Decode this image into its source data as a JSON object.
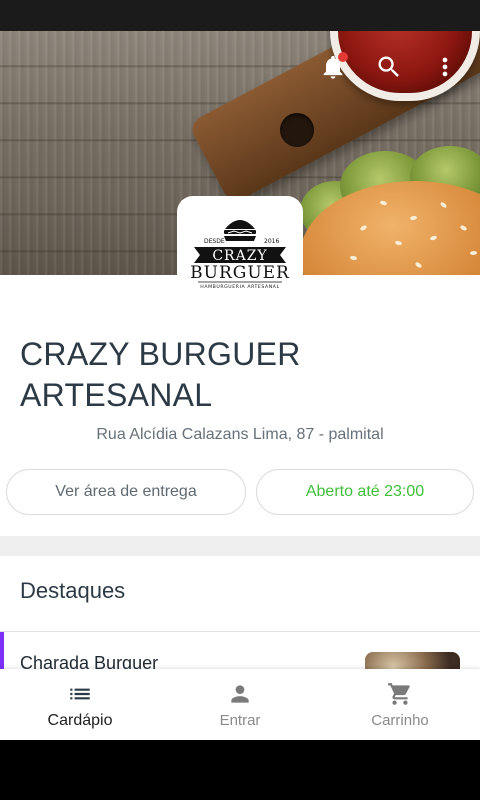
{
  "header": {
    "icons": [
      "notifications-icon",
      "search-icon",
      "more-vert-icon"
    ],
    "has_notification": true
  },
  "logo": {
    "since_left": "DESDE",
    "since_right": "2016",
    "line1": "CRAZY",
    "line2": "BURGUER",
    "tagline": "HAMBURGUERIA ARTESANAL"
  },
  "store": {
    "name": "CRAZY BURGUER ARTESANAL",
    "address": "Rua Alcídia Calazans Lima, 87 - palmital"
  },
  "actions": {
    "delivery_area": "Ver área de entrega",
    "open_status": "Aberto até 23:00"
  },
  "highlights": {
    "title": "Destaques",
    "items": [
      {
        "name": "Charada Burguer"
      }
    ]
  },
  "bottom_nav": {
    "items": [
      {
        "label": "Cardápio",
        "icon": "menu-list-icon",
        "active": true
      },
      {
        "label": "Entrar",
        "icon": "person-icon",
        "active": false
      },
      {
        "label": "Carrinho",
        "icon": "cart-icon",
        "active": false
      }
    ]
  },
  "colors": {
    "title": "#2b3a44",
    "open_green": "#3fbf3a",
    "accent_purple": "#7b2ff7",
    "notification_red": "#e53935"
  }
}
